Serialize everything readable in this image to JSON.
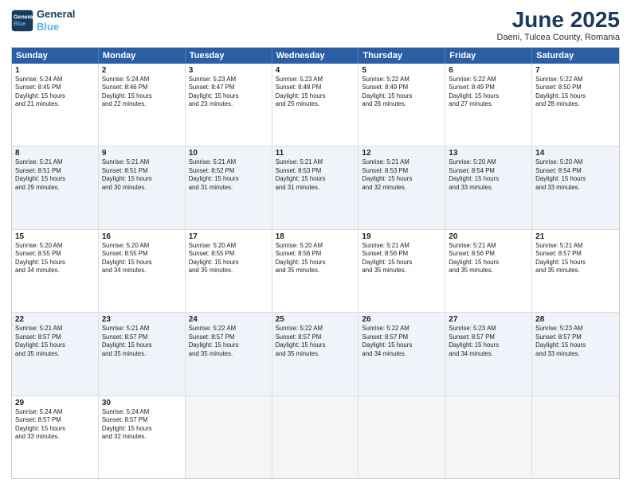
{
  "header": {
    "logo_line1": "General",
    "logo_line2": "Blue",
    "month_title": "June 2025",
    "subtitle": "Daeni, Tulcea County, Romania"
  },
  "weekdays": [
    "Sunday",
    "Monday",
    "Tuesday",
    "Wednesday",
    "Thursday",
    "Friday",
    "Saturday"
  ],
  "rows": [
    [
      {
        "day": "",
        "empty": true
      },
      {
        "day": "2",
        "rise": "5:24 AM",
        "set": "8:46 PM",
        "light": "15 hours and 22 minutes."
      },
      {
        "day": "3",
        "rise": "5:23 AM",
        "set": "8:47 PM",
        "light": "15 hours and 23 minutes."
      },
      {
        "day": "4",
        "rise": "5:23 AM",
        "set": "8:48 PM",
        "light": "15 hours and 25 minutes."
      },
      {
        "day": "5",
        "rise": "5:22 AM",
        "set": "8:49 PM",
        "light": "15 hours and 26 minutes."
      },
      {
        "day": "6",
        "rise": "5:22 AM",
        "set": "8:49 PM",
        "light": "15 hours and 27 minutes."
      },
      {
        "day": "7",
        "rise": "5:22 AM",
        "set": "8:50 PM",
        "light": "15 hours and 28 minutes."
      }
    ],
    [
      {
        "day": "1",
        "rise": "5:24 AM",
        "set": "8:45 PM",
        "light": "15 hours and 21 minutes.",
        "first": true
      },
      {
        "day": "8",
        "rise": "5:21 AM",
        "set": "8:51 PM",
        "light": "15 hours and 29 minutes."
      },
      {
        "day": "9",
        "rise": "5:21 AM",
        "set": "8:51 PM",
        "light": "15 hours and 30 minutes."
      },
      {
        "day": "10",
        "rise": "5:21 AM",
        "set": "8:52 PM",
        "light": "15 hours and 31 minutes."
      },
      {
        "day": "11",
        "rise": "5:21 AM",
        "set": "8:53 PM",
        "light": "15 hours and 31 minutes."
      },
      {
        "day": "12",
        "rise": "5:21 AM",
        "set": "8:53 PM",
        "light": "15 hours and 32 minutes."
      },
      {
        "day": "13",
        "rise": "5:20 AM",
        "set": "8:54 PM",
        "light": "15 hours and 33 minutes."
      }
    ],
    [
      {
        "day": "14",
        "rise": "5:20 AM",
        "set": "8:54 PM",
        "light": "15 hours and 33 minutes."
      },
      {
        "day": "15",
        "rise": "5:20 AM",
        "set": "8:55 PM",
        "light": "15 hours and 34 minutes."
      },
      {
        "day": "16",
        "rise": "5:20 AM",
        "set": "8:55 PM",
        "light": "15 hours and 34 minutes."
      },
      {
        "day": "17",
        "rise": "5:20 AM",
        "set": "8:55 PM",
        "light": "15 hours and 35 minutes."
      },
      {
        "day": "18",
        "rise": "5:20 AM",
        "set": "8:56 PM",
        "light": "15 hours and 35 minutes."
      },
      {
        "day": "19",
        "rise": "5:21 AM",
        "set": "8:56 PM",
        "light": "15 hours and 35 minutes."
      },
      {
        "day": "20",
        "rise": "5:21 AM",
        "set": "8:56 PM",
        "light": "15 hours and 35 minutes."
      }
    ],
    [
      {
        "day": "21",
        "rise": "5:21 AM",
        "set": "8:57 PM",
        "light": "15 hours and 35 minutes."
      },
      {
        "day": "22",
        "rise": "5:21 AM",
        "set": "8:57 PM",
        "light": "15 hours and 35 minutes."
      },
      {
        "day": "23",
        "rise": "5:21 AM",
        "set": "8:57 PM",
        "light": "15 hours and 35 minutes."
      },
      {
        "day": "24",
        "rise": "5:22 AM",
        "set": "8:57 PM",
        "light": "15 hours and 35 minutes."
      },
      {
        "day": "25",
        "rise": "5:22 AM",
        "set": "8:57 PM",
        "light": "15 hours and 35 minutes."
      },
      {
        "day": "26",
        "rise": "5:22 AM",
        "set": "8:57 PM",
        "light": "15 hours and 34 minutes."
      },
      {
        "day": "27",
        "rise": "5:23 AM",
        "set": "8:57 PM",
        "light": "15 hours and 34 minutes."
      }
    ],
    [
      {
        "day": "28",
        "rise": "5:23 AM",
        "set": "8:57 PM",
        "light": "15 hours and 33 minutes."
      },
      {
        "day": "29",
        "rise": "5:24 AM",
        "set": "8:57 PM",
        "light": "15 hours and 33 minutes."
      },
      {
        "day": "30",
        "rise": "5:24 AM",
        "set": "8:57 PM",
        "light": "15 hours and 32 minutes."
      },
      {
        "day": "",
        "empty": true
      },
      {
        "day": "",
        "empty": true
      },
      {
        "day": "",
        "empty": true
      },
      {
        "day": "",
        "empty": true
      }
    ]
  ]
}
